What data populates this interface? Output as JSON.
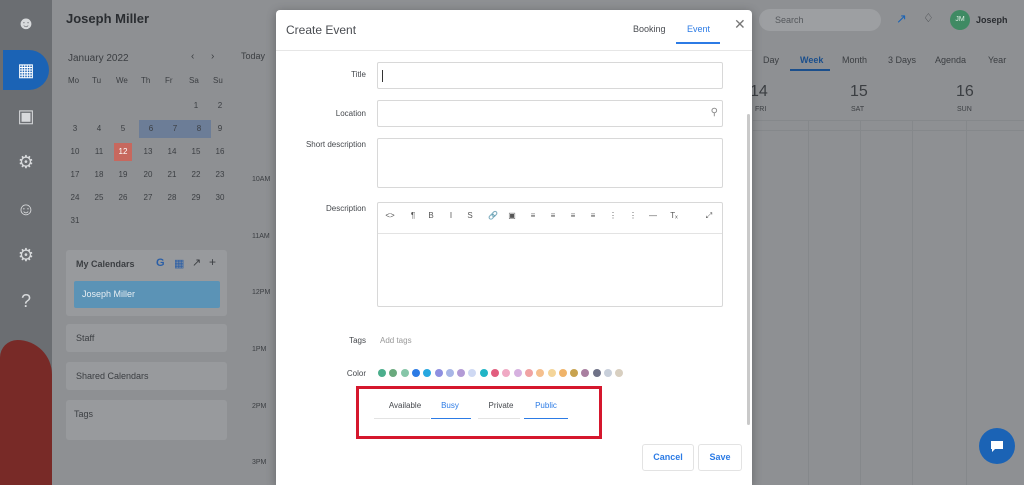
{
  "app": {
    "user_name": "Joseph Miller",
    "user_first": "Joseph",
    "initials": "JM",
    "search_placeholder": "Search"
  },
  "sidebar_icons": [
    "user-check-icon",
    "calendar-icon",
    "contacts-icon",
    "network-icon",
    "people-icon",
    "settings-icon",
    "help-icon"
  ],
  "mini_calendar": {
    "month": "January 2022",
    "weekdays": [
      "Mo",
      "Tu",
      "We",
      "Th",
      "Fr",
      "Sa",
      "Su"
    ],
    "weeks": [
      [
        "",
        "",
        "",
        "",
        "",
        "1",
        "2"
      ],
      [
        "3",
        "4",
        "5",
        "6",
        "7",
        "8",
        "9"
      ],
      [
        "10",
        "11",
        "12",
        "13",
        "14",
        "15",
        "16"
      ],
      [
        "17",
        "18",
        "19",
        "20",
        "21",
        "22",
        "23"
      ],
      [
        "24",
        "25",
        "26",
        "27",
        "28",
        "29",
        "30"
      ],
      [
        "31",
        "",
        "",
        "",
        "",
        "",
        ""
      ]
    ],
    "selected_range": [
      "6",
      "7",
      "8"
    ],
    "today": "12"
  },
  "panels": {
    "my_calendars": "My Calendars",
    "calendar_item": "Joseph Miller",
    "staff": "Staff",
    "shared_calendars": "Shared Calendars",
    "tags": "Tags"
  },
  "toolbar": {
    "today": "Today"
  },
  "views": [
    "Day",
    "Week",
    "Month",
    "3 Days",
    "Agenda",
    "Year"
  ],
  "active_view": "Week",
  "days": [
    {
      "num": "14",
      "name": "FRI"
    },
    {
      "num": "15",
      "name": "SAT"
    },
    {
      "num": "16",
      "name": "SUN"
    }
  ],
  "times": [
    "10AM",
    "11AM",
    "12PM",
    "1PM",
    "2PM",
    "3PM"
  ],
  "modal": {
    "title": "Create Event",
    "tabs": [
      "Booking",
      "Event"
    ],
    "active_tab": "Event",
    "fields": {
      "title": "Title",
      "location": "Location",
      "short_description": "Short description",
      "description": "Description",
      "tags": "Tags",
      "color": "Color"
    },
    "tags_placeholder": "Add tags",
    "editor_tools": [
      "<>",
      "¶",
      "B",
      "I",
      "S",
      "link",
      "image",
      "align-left",
      "align-center",
      "align-right",
      "justify",
      "ordered-list",
      "bullet-list",
      "hr",
      "Tx",
      "fullscreen"
    ],
    "colors": [
      "#4cae8c",
      "#6aaa7e",
      "#86c6a8",
      "#2c7be5",
      "#27a8e0",
      "#8e8fe0",
      "#a8b6e6",
      "#b39bd6",
      "#cfd9f3",
      "#21b5c6",
      "#e25d7e",
      "#f0a9c4",
      "#d6b1e0",
      "#f0a3a3",
      "#f5c08e",
      "#f4d59a",
      "#f0b46a",
      "#c8a34f",
      "#a97fa0",
      "#6f7287",
      "#c8cfda",
      "#d8cfc0"
    ],
    "status_left": {
      "options": [
        "Available",
        "Busy"
      ],
      "selected": "Busy"
    },
    "status_right": {
      "options": [
        "Private",
        "Public"
      ],
      "selected": "Public"
    },
    "buttons": {
      "cancel": "Cancel",
      "save": "Save"
    }
  }
}
